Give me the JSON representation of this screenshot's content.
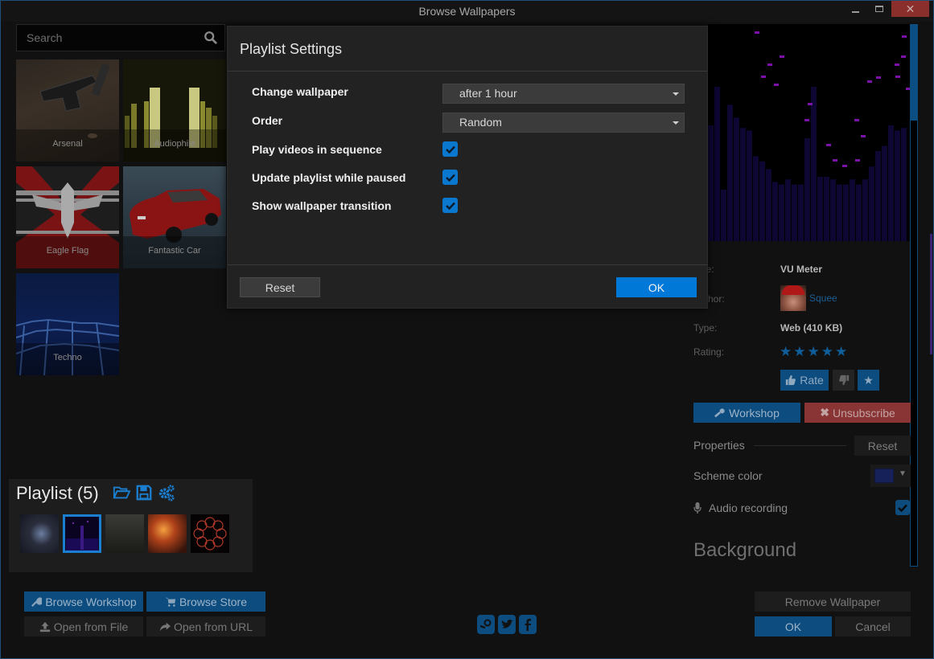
{
  "window": {
    "title": "Browse Wallpapers",
    "controls": {
      "minimize": "minimize",
      "maximize": "maximize",
      "close": "✕"
    }
  },
  "search": {
    "placeholder": "Search",
    "value": ""
  },
  "wallpapers": [
    {
      "name": "Arsenal"
    },
    {
      "name": "Audiophile"
    },
    {
      "name": "Eagle Flag"
    },
    {
      "name": "Fantastic Car"
    },
    {
      "name": "Techno"
    }
  ],
  "playlist": {
    "title": "Playlist (5)",
    "count": 5,
    "selected_index": 1,
    "icons": [
      "folder-open-icon",
      "save-icon",
      "cogs-icon"
    ]
  },
  "bottom_left": {
    "browse_workshop": "Browse Workshop",
    "browse_store": "Browse Store",
    "open_file": "Open from File",
    "open_url": "Open from URL"
  },
  "social": [
    "steam-icon",
    "twitter-icon",
    "facebook-icon"
  ],
  "details": {
    "title_label": "Title:",
    "title_value": "VU Meter",
    "author_label": "Author:",
    "author_value": "Squee",
    "type_label": "Type:",
    "type_value": "Web (410 KB)",
    "rating_label": "Rating:",
    "rating_stars": 5,
    "rate_label": "Rate",
    "workshop_label": "Workshop",
    "unsubscribe_label": "Unsubscribe"
  },
  "properties": {
    "heading": "Properties",
    "reset_label": "Reset",
    "scheme_color_label": "Scheme color",
    "scheme_color_value": "#16215a",
    "audio_recording_label": "Audio recording",
    "audio_recording_checked": true,
    "background_heading": "Background"
  },
  "bottom_right": {
    "remove_wallpaper": "Remove Wallpaper",
    "ok": "OK",
    "cancel": "Cancel"
  },
  "modal": {
    "title": "Playlist Settings",
    "change_wallpaper_label": "Change wallpaper",
    "change_wallpaper_value": "after 1 hour",
    "order_label": "Order",
    "order_value": "Random",
    "checkboxes": [
      {
        "label": "Play videos in sequence",
        "checked": true
      },
      {
        "label": "Update playlist while paused",
        "checked": true
      },
      {
        "label": "Show wallpaper transition",
        "checked": true
      }
    ],
    "reset_label": "Reset",
    "ok_label": "OK"
  },
  "colors": {
    "accent_blue": "#0078d7",
    "dark_blue": "#0d4c7e",
    "unsubscribe_red": "#8a3535",
    "close_red": "#8a2f2c"
  }
}
